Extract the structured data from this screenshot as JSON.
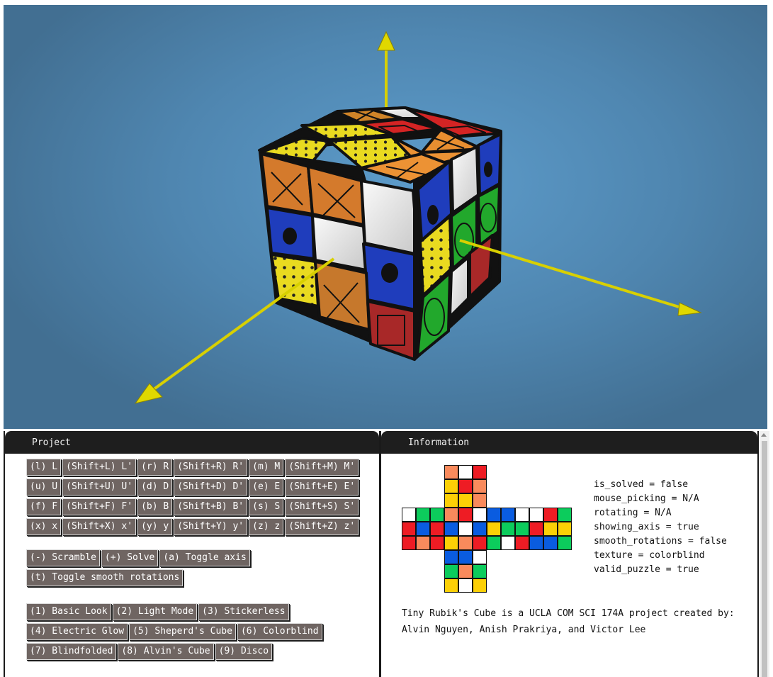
{
  "project": {
    "title": "Project",
    "move_rows": [
      [
        "(l) L",
        "(Shift+L) L'",
        "(r) R",
        "(Shift+R) R'",
        "(m) M",
        "(Shift+M) M'"
      ],
      [
        "(u) U",
        "(Shift+U) U'",
        "(d) D",
        "(Shift+D) D'",
        "(e) E",
        "(Shift+E) E'"
      ],
      [
        "(f) F",
        "(Shift+F) F'",
        "(b) B",
        "(Shift+B) B'",
        "(s) S",
        "(Shift+S) S'"
      ],
      [
        "(x) x",
        "(Shift+X) x'",
        "(y) y",
        "(Shift+Y) y'",
        "(z) z",
        "(Shift+Z) z'"
      ]
    ],
    "control_rows": [
      [
        "(-) Scramble",
        "(+) Solve",
        "(a) Toggle axis"
      ],
      [
        "(t) Toggle smooth rotations"
      ]
    ],
    "theme_rows": [
      [
        "(1) Basic Look",
        "(2) Light Mode",
        "(3) Stickerless"
      ],
      [
        "(4) Electric Glow",
        "(5) Sheperd's Cube",
        "(6) Colorblind"
      ],
      [
        "(7) Blindfolded",
        "(8) Alvin's Cube",
        "(9) Disco"
      ]
    ]
  },
  "information": {
    "title": "Information",
    "status": [
      "is_solved = false",
      "mouse_picking = N/A",
      "rotating = N/A",
      "showing_axis = true",
      "smooth_rotations = false",
      "texture = colorblind",
      "valid_puzzle = true"
    ],
    "credits_line1": "Tiny Rubik's Cube is a UCLA COM SCI 174A project created by:",
    "credits_line2": "Alvin Nguyen, Anish Prakriya, and Victor Lee"
  },
  "colors": {
    "R": "#ee1c24",
    "O": "#f98a5c",
    "Y": "#fcd006",
    "W": "#ffffff",
    "G": "#0ccc5c",
    "B": "#0a5ce0",
    "button_bg": "#6f6562",
    "panel_header": "#1e1e1e"
  },
  "cube_net": {
    "top": [
      "OWR",
      "YRO",
      "YYO"
    ],
    "middle": [
      "WGGORWBBWWRG",
      "RBRBWBYGGRYY",
      "RORYORGWRBBG"
    ],
    "bottom": [
      "BBW",
      "GOG",
      "YWY"
    ]
  }
}
